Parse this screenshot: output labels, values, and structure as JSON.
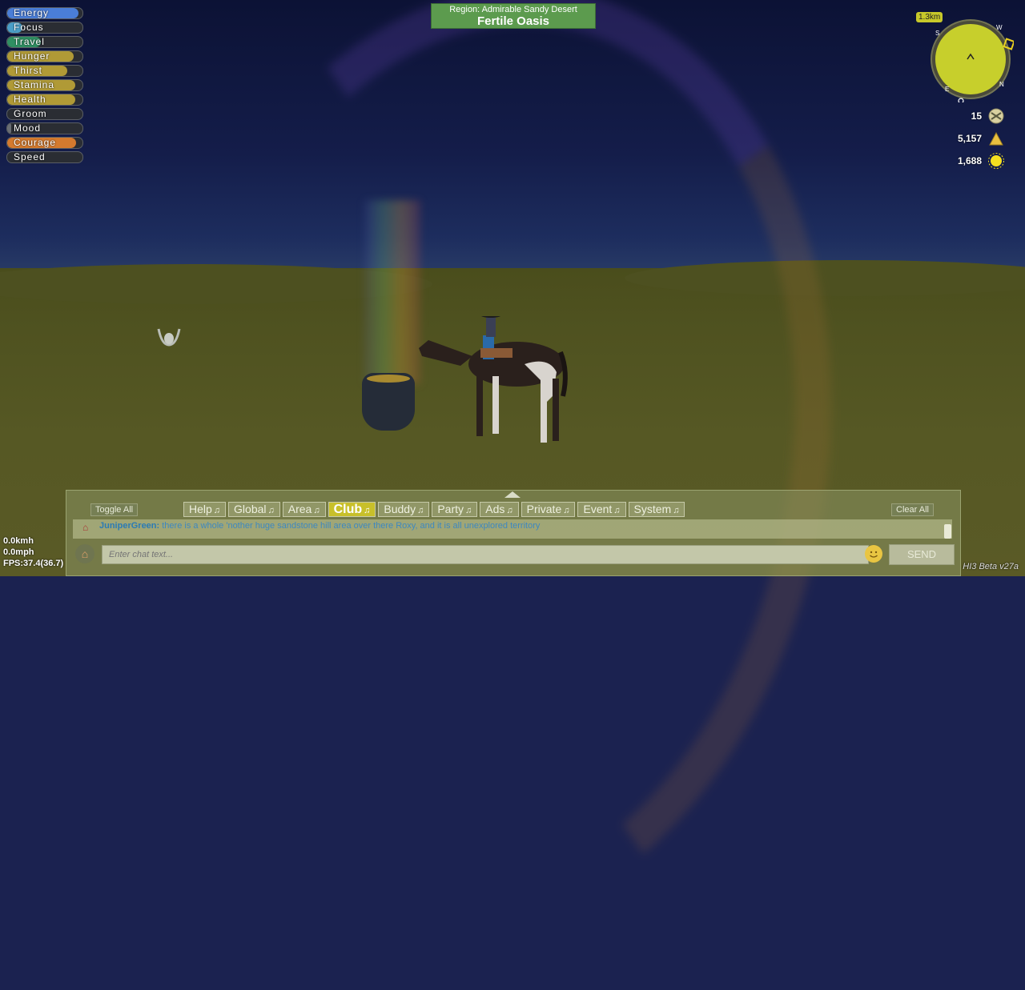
{
  "stats": [
    {
      "label": "Energy",
      "level": 0.95,
      "color": "#4a7ed8"
    },
    {
      "label": "Focus",
      "level": 0.2,
      "color": "#4a9ec8"
    },
    {
      "label": "Travel",
      "level": 0.45,
      "color": "#2f8f62"
    },
    {
      "label": "Hunger",
      "level": 0.88,
      "color": "#b09a36"
    },
    {
      "label": "Thirst",
      "level": 0.8,
      "color": "#b09a36"
    },
    {
      "label": "Stamina",
      "level": 0.9,
      "color": "#b09a36"
    },
    {
      "label": "Health",
      "level": 0.9,
      "color": "#b09a36"
    },
    {
      "label": "Groom",
      "level": 0.0,
      "color": "#6a6e74"
    },
    {
      "label": "Mood",
      "level": 0.05,
      "color": "#6a6e74"
    },
    {
      "label": "Courage",
      "level": 0.92,
      "color": "#d47a2e"
    },
    {
      "label": "Speed",
      "level": 0.0,
      "color": "#6a6e74"
    }
  ],
  "region": {
    "subtitle": "Region: Admirable Sandy Desert",
    "name": "Fertile Oasis"
  },
  "compass": {
    "distance": "1.3km",
    "letters": [
      "W",
      "S",
      "E",
      "N"
    ]
  },
  "currencies": [
    {
      "value": "15",
      "icon": "ribbon-token-icon"
    },
    {
      "value": "5,157",
      "icon": "gold-pile-icon"
    },
    {
      "value": "1,688",
      "icon": "sun-coin-icon"
    }
  ],
  "chat": {
    "toggle_all": "Toggle All",
    "clear_all": "Clear All",
    "tabs": [
      "Help",
      "Global",
      "Area",
      "Club",
      "Buddy",
      "Party",
      "Ads",
      "Private",
      "Event",
      "System"
    ],
    "active_tab": "Club",
    "message_user": "JuniperGreen:",
    "message_text": "there is a whole 'nother huge sandstone hill area over there Roxy, and it is all unexplored territory",
    "placeholder": "Enter chat text...",
    "send": "SEND"
  },
  "speed": {
    "kmh": "0.0kmh",
    "mph": "0.0mph",
    "fps": "FPS:37.4(36.7)"
  },
  "version": "HI3 Beta v27a"
}
